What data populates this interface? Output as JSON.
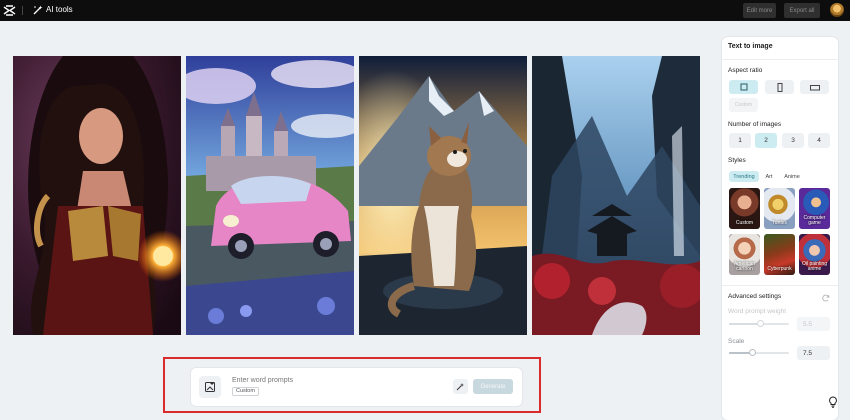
{
  "topbar": {
    "section": "AI tools",
    "edit_more_label": "Edit more",
    "export_all_label": "Export all"
  },
  "gallery": {
    "images": [
      {
        "icon": "fantasy-warrior-woman-image"
      },
      {
        "icon": "pink-car-castle-image"
      },
      {
        "icon": "cat-mountain-sunset-image"
      },
      {
        "icon": "misty-valley-temple-image"
      }
    ]
  },
  "prompt": {
    "placeholder": "Enter word prompts",
    "tag": "Custom",
    "generate_label": "Generate"
  },
  "panel": {
    "title": "Text to image",
    "aspect_ratio_label": "Aspect ratio",
    "aspect_ratio_custom": "Custom",
    "number_of_images_label": "Number of images",
    "numbers": [
      "1",
      "2",
      "3",
      "4"
    ],
    "selected_number": "2",
    "styles_label": "Styles",
    "style_tabs": [
      "Trending",
      "Art",
      "Anime"
    ],
    "style_cards": [
      "Custom",
      "Turtles",
      "Computer game",
      "American cartoon",
      "Cyberpunk",
      "Oil painting anime"
    ],
    "advanced_label": "Advanced settings",
    "word_prompt_weight_label": "Word prompt weight",
    "word_prompt_weight_value": "5.5",
    "scale_label": "Scale",
    "scale_value": "7.5"
  },
  "colors": {
    "accent": "#ccecf1",
    "highlight": "#d92b2b",
    "topbar": "#0d0d0d"
  }
}
